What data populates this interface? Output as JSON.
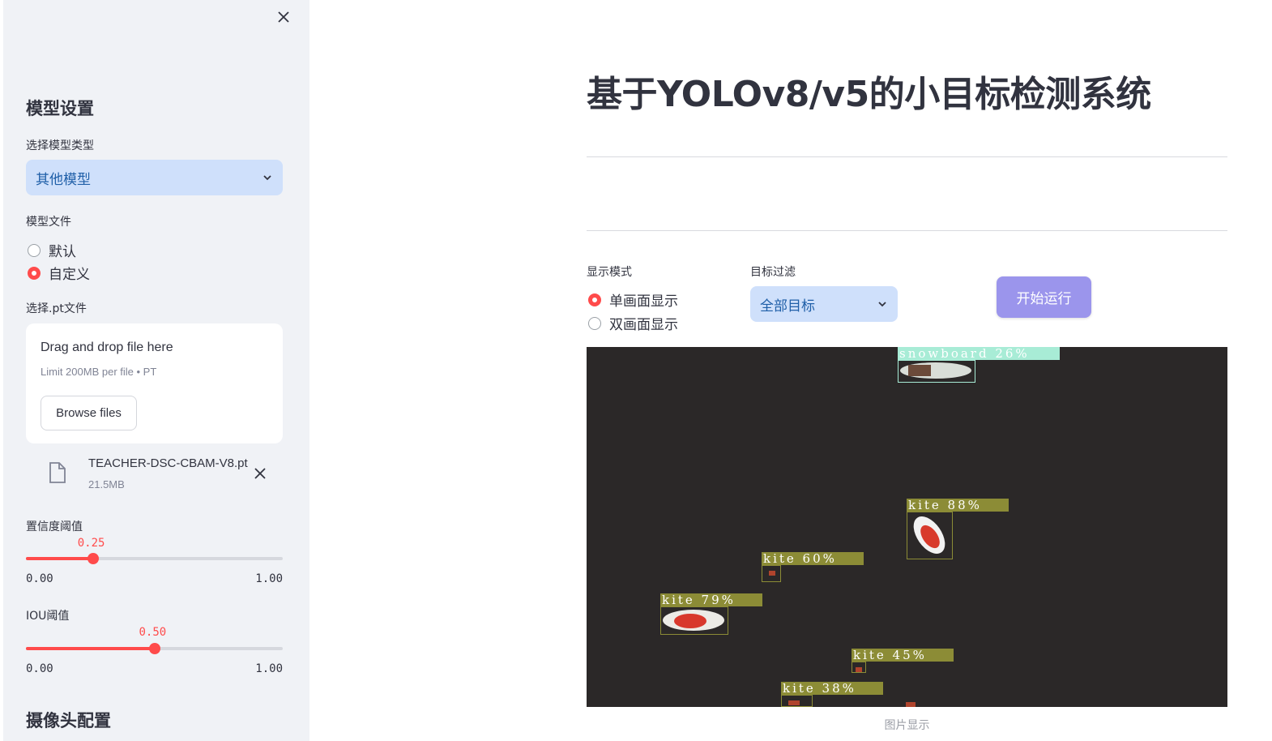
{
  "sidebar": {
    "model_section_title": "模型设置",
    "model_type_label": "选择模型类型",
    "model_type_value": "其他模型",
    "model_file_label": "模型文件",
    "model_file_options": [
      "默认",
      "自定义"
    ],
    "model_file_selected": "自定义",
    "pt_file_label": "选择.pt文件",
    "uploader": {
      "drag_text": "Drag and drop file here",
      "limit_text": "Limit 200MB per file • PT",
      "browse_label": "Browse files"
    },
    "uploaded_file": {
      "name": "TEACHER-DSC-CBAM-V8.pt",
      "size": "21.5MB"
    },
    "confidence": {
      "label": "置信度阈值",
      "value": "0.25",
      "min": "0.00",
      "max": "1.00",
      "fraction": 0.25
    },
    "iou": {
      "label": "IOU阈值",
      "value": "0.50",
      "min": "0.00",
      "max": "1.00",
      "fraction": 0.5
    },
    "camera_section_title": "摄像头配置"
  },
  "main": {
    "title": "基于YOLOv8/v5的小目标检测系统",
    "display_mode_label": "显示模式",
    "display_mode_options": [
      "单画面显示",
      "双画面显示"
    ],
    "display_mode_selected": "单画面显示",
    "target_filter_label": "目标过滤",
    "target_filter_value": "全部目标",
    "run_button": "开始运行",
    "image_caption": "图片显示",
    "detections": [
      {
        "label": "snowboard 26%",
        "color": "#a8ecd6"
      },
      {
        "label": "kite 88%",
        "color": "#8c8c36"
      },
      {
        "label": "kite 60%",
        "color": "#8c8c36"
      },
      {
        "label": "kite 79%",
        "color": "#8c8c36"
      },
      {
        "label": "kite 45%",
        "color": "#8c8c36"
      },
      {
        "label": "kite 38%",
        "color": "#8c8c36"
      }
    ]
  },
  "colors": {
    "accent": "#ff4b4b",
    "select_bg": "#cfe0fb",
    "run_button": "#9b95ec",
    "image_bg": "#2b2828"
  },
  "icons": {
    "close": "close-icon",
    "chevron": "chevron-down-icon",
    "file": "file-icon"
  }
}
